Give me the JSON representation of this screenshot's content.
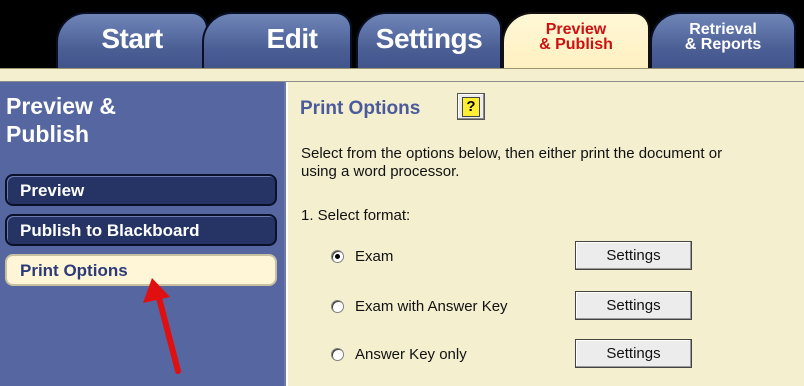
{
  "tabs": [
    {
      "label": "Start",
      "active": false
    },
    {
      "label": "Edit",
      "active": false
    },
    {
      "label": "Settings",
      "active": false
    },
    {
      "label_line1": "Preview",
      "label_line2": "& Publish",
      "active": true
    },
    {
      "label_line1": "Retrieval",
      "label_line2": "& Reports",
      "active": false
    }
  ],
  "sidebar": {
    "title_line1": "Preview &",
    "title_line2": "Publish",
    "items": [
      {
        "label": "Preview",
        "active": false
      },
      {
        "label": "Publish to Blackboard",
        "active": false
      },
      {
        "label": "Print Options",
        "active": true
      }
    ]
  },
  "main": {
    "heading": "Print Options",
    "help_label": "?",
    "description_line1": "Select from the options below, then either print the document or",
    "description_line2": "using a word processor.",
    "step1_label": "1.  Select format:",
    "options": [
      {
        "label": "Exam",
        "selected": true,
        "button": "Settings"
      },
      {
        "label": "Exam with Answer Key",
        "selected": false,
        "button": "Settings"
      },
      {
        "label": "Answer Key only",
        "selected": false,
        "button": "Settings"
      }
    ]
  },
  "colors": {
    "sidebar_bg": "#5566a0",
    "content_bg": "#f4efcf",
    "active_tab_text": "#cc1111",
    "heading_text": "#4a5a9c",
    "arrow": "#e01010"
  }
}
